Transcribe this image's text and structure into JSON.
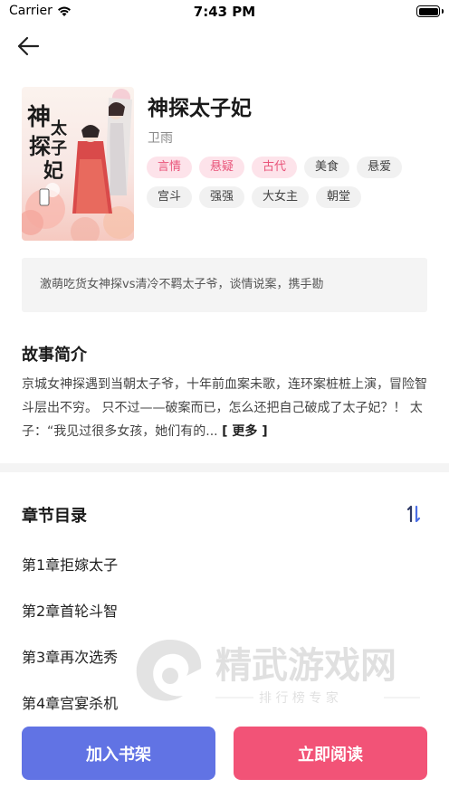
{
  "status_bar": {
    "carrier": "Carrier",
    "time": "7:43 PM",
    "battery_level": 1.0
  },
  "book": {
    "title": "神探太子妃",
    "author": "卫雨",
    "cover_title": "神探太子妃",
    "tags": [
      {
        "label": "言情",
        "highlight": true
      },
      {
        "label": "悬疑",
        "highlight": true
      },
      {
        "label": "古代",
        "highlight": true
      },
      {
        "label": "美食",
        "highlight": false
      },
      {
        "label": "悬爱",
        "highlight": false
      },
      {
        "label": "宫斗",
        "highlight": false
      },
      {
        "label": "强强",
        "highlight": false
      },
      {
        "label": "大女主",
        "highlight": false
      },
      {
        "label": "朝堂",
        "highlight": false
      }
    ],
    "summary": "激萌吃货女神探vs清冷不羁太子爷，谈情说案，携手勘"
  },
  "intro": {
    "title": "故事简介",
    "text": "京城女神探遇到当朝太子爷，十年前血案未歌，连环案桩桩上演，冒险智斗层出不穷。 只不过——破案而已，怎么还把自己破成了太子妃？！ 太子：“我见过很多女孩，她们有的...",
    "more": "[ 更多 ]"
  },
  "chapters": {
    "title": "章节目录",
    "items": [
      "第1章拒嫁太子",
      "第2章首轮斗智",
      "第3章再次选秀",
      "第4章宫宴杀机"
    ]
  },
  "watermark": {
    "name": "精武游戏网",
    "slogan": "排 行 榜 专 家"
  },
  "actions": {
    "add_shelf": "加入书架",
    "read_now": "立即阅读"
  },
  "colors": {
    "primary_blue": "#6173e4",
    "primary_pink": "#f25377",
    "tag_pink": "#e9547a"
  }
}
